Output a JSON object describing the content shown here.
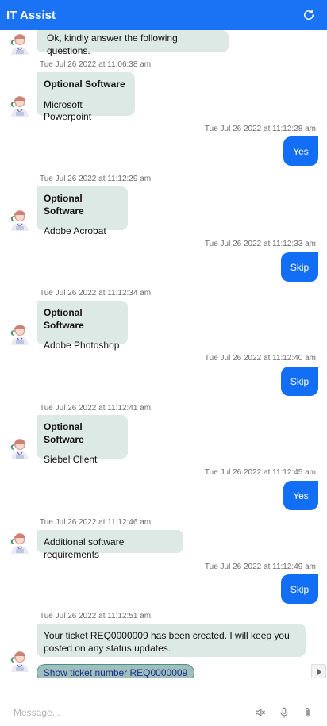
{
  "header": {
    "title": "IT Assist",
    "refresh_icon": "refresh-icon"
  },
  "messages": [
    {
      "from": "bot",
      "text": "Ok, kindly answer the following questions."
    },
    {
      "from": "bot",
      "timestamp": "Tue Jul 26 2022 at 11:06:38 am",
      "heading": "Optional Software",
      "text": "Microsoft Powerpoint"
    },
    {
      "from": "user",
      "timestamp": "Tue Jul 26 2022 at 11:12:28 am",
      "text": "Yes"
    },
    {
      "from": "bot",
      "timestamp": "Tue Jul 26 2022 at 11:12:29 am",
      "heading": "Optional Software",
      "text": "Adobe Acrobat"
    },
    {
      "from": "user",
      "timestamp": "Tue Jul 26 2022 at 11:12:33 am",
      "text": "Skip"
    },
    {
      "from": "bot",
      "timestamp": "Tue Jul 26 2022 at 11:12:34 am",
      "heading": "Optional Software",
      "text": "Adobe Photoshop"
    },
    {
      "from": "user",
      "timestamp": "Tue Jul 26 2022 at 11:12:40 am",
      "text": "Skip"
    },
    {
      "from": "bot",
      "timestamp": "Tue Jul 26 2022 at 11:12:41 am",
      "heading": "Optional Software",
      "text": "Siebel Client"
    },
    {
      "from": "user",
      "timestamp": "Tue Jul 26 2022 at 11:12:45 am",
      "text": "Yes"
    },
    {
      "from": "bot",
      "timestamp": "Tue Jul 26 2022 at 11:12:46 am",
      "text": "Additional software requirements"
    },
    {
      "from": "user",
      "timestamp": "Tue Jul 26 2022 at 11:12:49 am",
      "text": "Skip"
    },
    {
      "from": "bot",
      "timestamp": "Tue Jul 26 2022 at 11:12:51 am",
      "text": "Your ticket REQ0000009 has been created. I will keep you posted on any status updates."
    }
  ],
  "ticket_button": {
    "label": "Show ticket number REQ0000009"
  },
  "composer": {
    "placeholder": "Message...",
    "icons": [
      "mute-icon",
      "microphone-icon",
      "attachment-icon"
    ]
  },
  "colors": {
    "header": "#1a73f5",
    "user_bubble": "#116ef5",
    "bot_bubble": "#dce9e4"
  }
}
